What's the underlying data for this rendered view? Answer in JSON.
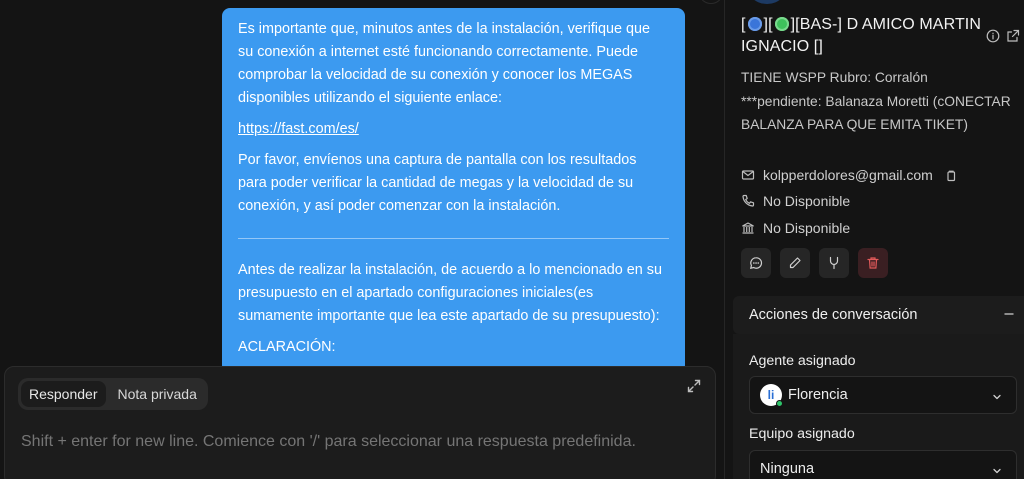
{
  "message": {
    "paragraph_1": "Es importante que, minutos antes de la instalación, verifique que su conexión a internet esté funcionando correctamente. Puede comprobar la velocidad de su conexión y conocer los MEGAS disponibles utilizando el siguiente enlace:",
    "link": "https://fast.com/es/",
    "paragraph_2": "Por favor, envíenos una captura de pantalla con los resultados para poder verificar la cantidad de megas y la velocidad de su conexión, y así poder comenzar con la instalación.",
    "paragraph_3": "Antes de realizar la instalación, de acuerdo a lo mencionado en su presupuesto en el apartado configuraciones iniciales(es sumamente importante que lea este apartado de su presupuesto):",
    "paragraph_4": "ACLARACIÓN:",
    "bubble_color": "#3c9af0"
  },
  "reply": {
    "tabs": [
      "Responder",
      "Nota privada"
    ],
    "active_tab": "Responder",
    "placeholder": "Shift + enter for new line. Comience con '/' para seleccionar una respuesta predefinida."
  },
  "contact": {
    "name_prefix_open": "[",
    "name_mid_sep": "][",
    "name_rest": "][BAS-] D AMICO MARTIN IGNACIO []",
    "notes": "TIENE WSPP Rubro: Corralón ***pendiente: Balanaza Moretti (cONECTAR BALANZA PARA QUE EMITA TIKET)",
    "email": "kolpperdolores@gmail.com",
    "phone": "No Disponible",
    "company": "No Disponible"
  },
  "conversation_actions": {
    "title": "Acciones de conversación",
    "assigned_agent_label": "Agente asignado",
    "assigned_agent": "Florencia",
    "assigned_team_label": "Equipo asignado",
    "assigned_team": "Ninguna"
  },
  "icons": [
    "expand-icon",
    "info-icon",
    "external-link-icon",
    "mail-icon",
    "phone-icon",
    "bank-icon",
    "copy-icon",
    "chat-icon",
    "edit-icon",
    "merge-icon",
    "trash-icon",
    "minus-icon",
    "chevron-down-icon"
  ]
}
